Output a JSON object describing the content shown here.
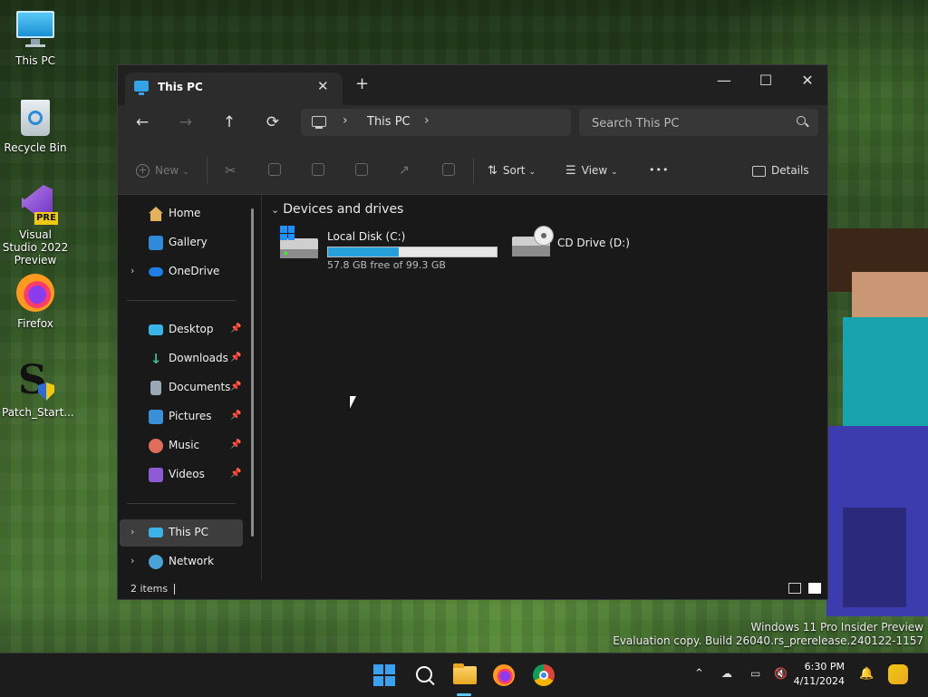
{
  "desktop": {
    "icons": [
      {
        "label": "This PC"
      },
      {
        "label": "Recycle Bin"
      },
      {
        "label": "Visual Studio 2022 Preview",
        "badge": "PRE"
      },
      {
        "label": "Firefox"
      },
      {
        "label": "Patch_Start..."
      }
    ],
    "watermark_line1": "Windows 11 Pro Insider Preview",
    "watermark_line2": "Evaluation copy. Build 26040.rs_prerelease.240122-1157"
  },
  "window": {
    "tab_title": "This PC",
    "tab_close": "✕",
    "new_tab": "+",
    "minimize": "—",
    "maximize": "☐",
    "close": "✕",
    "nav": {
      "back": "←",
      "forward": "→",
      "up": "↑",
      "refresh": "⟳"
    },
    "breadcrumb": {
      "sep": "›",
      "current": "This PC"
    },
    "search_placeholder": "Search This PC",
    "commands": {
      "new_label": "New",
      "sort_label": "Sort",
      "view_label": "View",
      "more": "•••",
      "details_label": "Details"
    },
    "sidebar": {
      "items": [
        {
          "label": "Home",
          "color": "#e3b25a"
        },
        {
          "label": "Gallery",
          "color": "#2f8bd8"
        },
        {
          "label": "OneDrive",
          "color": "#1f7ee8"
        },
        {
          "label": "Desktop",
          "color": "#3ab3e8"
        },
        {
          "label": "Downloads",
          "color": "#3cc08a"
        },
        {
          "label": "Documents",
          "color": "#9aa7b5"
        },
        {
          "label": "Pictures",
          "color": "#3a8fd6"
        },
        {
          "label": "Music",
          "color": "#e06c5c"
        },
        {
          "label": "Videos",
          "color": "#8e5bd6"
        },
        {
          "label": "This PC",
          "color": "#3ab3e8"
        },
        {
          "label": "Network",
          "color": "#4aa3d6"
        }
      ],
      "pin": "📌",
      "chevron": "›"
    },
    "content": {
      "group_label": "Devices and drives",
      "group_chevron": "⌄",
      "drives": [
        {
          "name": "Local Disk (C:)",
          "free": "57.8 GB free of 99.3 GB",
          "used_fraction": 0.418
        },
        {
          "name": "CD Drive (D:)"
        }
      ]
    },
    "status": {
      "items": "2 items"
    }
  },
  "taskbar": {
    "time": "6:30 PM",
    "date": "4/11/2024",
    "tray_chevron": "⌃",
    "accent": "#5cc8ff"
  }
}
